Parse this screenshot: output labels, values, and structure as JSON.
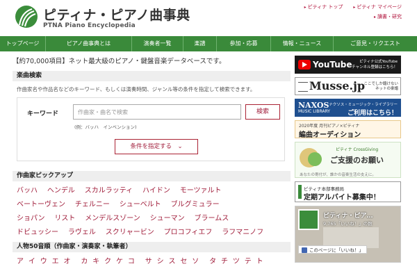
{
  "header": {
    "logo_title": "ピティナ・ピアノ曲事典",
    "logo_sub": "PTNA Piano Encyclopedia",
    "top_links": [
      "ピティナ トップ",
      "ピティナ マイページ",
      "讀書・研究"
    ]
  },
  "nav": {
    "items": [
      "トップページ",
      "ピアノ曲事典とは",
      "演奏者一覧",
      "楽譜",
      "参加・応募",
      "情報・ニュース",
      "ご意見・リクエスト"
    ]
  },
  "main": {
    "intro": "【約70,000項目】ネット最大級のピアノ・鍵盤音楽データベースです。",
    "search": {
      "title": "楽曲検索",
      "description": "作曲家名や作品名などのキーワード、もしくは演奏時間、ジャンル等の条件を指定して検索できます。",
      "keyword_label": "キーワード",
      "placeholder": "作曲家・曲名で検索",
      "button": "検索",
      "example": "(例：バッハ　インベンション)",
      "condition_button": "条件を指定する　⌄"
    },
    "pickup": {
      "title": "作曲家ピックアップ",
      "rows": [
        [
          "バッハ",
          "ヘンデル",
          "スカルラッティ",
          "ハイドン",
          "モーツァルト"
        ],
        [
          "ベートーヴェン",
          "チェルニー",
          "シューベルト",
          "ブルグミュラー"
        ],
        [
          "ショパン",
          "リスト",
          "メンデルスゾーン",
          "シューマン",
          "ブラームス"
        ],
        [
          "ドビュッシー",
          "ラヴェル",
          "スクリャービン",
          "プロコフィエフ",
          "ラフマニノフ"
        ]
      ]
    },
    "kana": {
      "title": "人物50音順（作曲家・演奏家・執筆者）",
      "groups": [
        [
          "ア",
          "イ",
          "ウ",
          "エ",
          "オ"
        ],
        [
          "カ",
          "キ",
          "ク",
          "ケ",
          "コ"
        ],
        [
          "サ",
          "シ",
          "ス",
          "セ",
          "ソ"
        ],
        [
          "タ",
          "チ",
          "ツ",
          "テ",
          "ト"
        ]
      ]
    }
  },
  "sidebar": {
    "youtube": {
      "word": "YouTube",
      "side1": "ピティナ公式YouTube",
      "side2": "チャンネル登録はこちら！"
    },
    "musse": {
      "word": "Musse.jp",
      "side1": "ここでしか聴けない",
      "side2": "ネットの楽譜"
    },
    "naxos": {
      "word": "NAXOS",
      "sub": "MUSIC LIBRARY",
      "side1": "ナクソス・ミュージック・ライブラリー",
      "side2": "ご利用はこちら！"
    },
    "arrange": {
      "small": "2020年度 月刊ピアノ×ピティナ",
      "big": "編曲オーディション"
    },
    "crossgiving": {
      "small": "ピティナ CrossGiving",
      "big": "ご支援のお願い",
      "foot": "あなたの寄付が、誰かの音楽生活の支えに。"
    },
    "job": {
      "small": "ピティナ本部事務局",
      "big": "定期アルバイト募集中！"
    },
    "facebook": {
      "name": "ピティナ・ピア…",
      "likes": "9,765「いいね！」の数",
      "like_bar": "このページに「いいね！」"
    }
  },
  "colors": {
    "brand_green": "#3a8a3a",
    "link_red": "#a01c3a"
  }
}
